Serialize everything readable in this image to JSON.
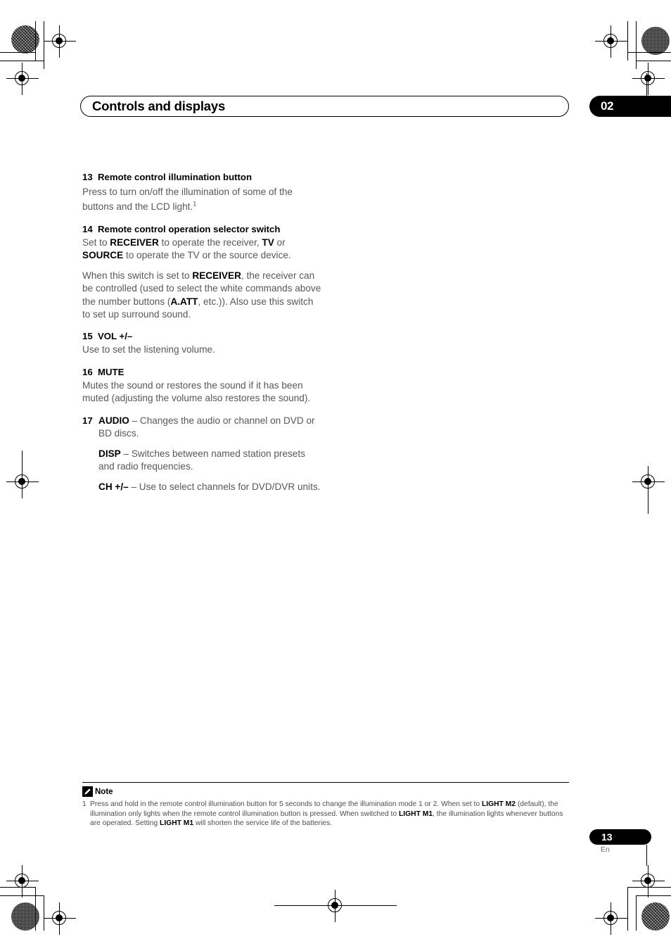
{
  "header": {
    "title": "Controls and displays",
    "chapter": "02"
  },
  "items": [
    {
      "number": "13",
      "title": "Remote control illumination button",
      "body_html": "Press to turn on/off the illumination of some of the buttons and the LCD light.<sup>1</sup>"
    },
    {
      "number": "14",
      "title": "Remote control operation selector switch",
      "body_html": "<p>Set to <b>RECEIVER</b> to operate the receiver, <b>TV</b> or <b>SOURCE</b> to operate the TV or the source device.</p><p>When this switch is set to <b>RECEIVER</b>, the receiver can be controlled (used to select the white commands above the number buttons (<b>A.ATT</b>, etc.)). Also use this switch to set up surround sound.</p>"
    },
    {
      "number": "15",
      "title": "VOL +/–",
      "body_html": "Use to set the listening volume."
    },
    {
      "number": "16",
      "title": "MUTE",
      "body_html": "Mutes the sound or restores the sound if it has been muted (adjusting the volume also restores the sound)."
    }
  ],
  "item17": {
    "number": "17",
    "body_html": "<p><b>AUDIO</b> – Changes the audio or channel on DVD or BD discs.</p><p><b>DISP</b> – Switches between named station presets and radio frequencies.</p><p><b>CH +/–</b> – Use to select channels for DVD/DVR units.</p>"
  },
  "note": {
    "label": "Note",
    "number": "1",
    "text_html": "Press and hold in the remote control illumination button for 5 seconds to change the illumination mode 1 or 2. When set to <b>LIGHT M2</b> (default), the illumination only lights when the remote control illumination button is pressed. When switched to <b>LIGHT M1</b>, the illumination lights whenever buttons are operated. Setting <b>LIGHT M1</b> will shorten the service life of the batteries."
  },
  "footer": {
    "page_number": "13",
    "language": "En"
  }
}
